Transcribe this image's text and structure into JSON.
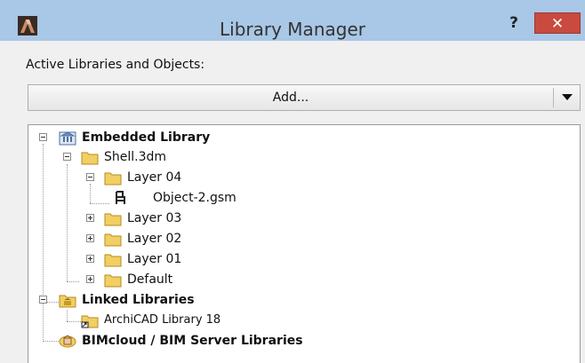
{
  "window": {
    "title": "Library Manager",
    "help_label": "?",
    "close_label": "✕"
  },
  "section": {
    "label": "Active Libraries and Objects:"
  },
  "add_bar": {
    "label": "Add..."
  },
  "tree": {
    "embedded": "Embedded Library",
    "shell": "Shell.3dm",
    "layer04": "Layer 04",
    "object2": "Object-2.gsm",
    "layer03": "Layer 03",
    "layer02": "Layer 02",
    "layer01": "Layer 01",
    "default": "Default",
    "linked": "Linked Libraries",
    "archicad": "ArchiCAD Library 18",
    "bimcloud": "BIMcloud / BIM Server Libraries"
  },
  "colors": {
    "titlebar": "#a9c7e6",
    "close": "#c94a3e",
    "folder": "#f2cf63"
  }
}
